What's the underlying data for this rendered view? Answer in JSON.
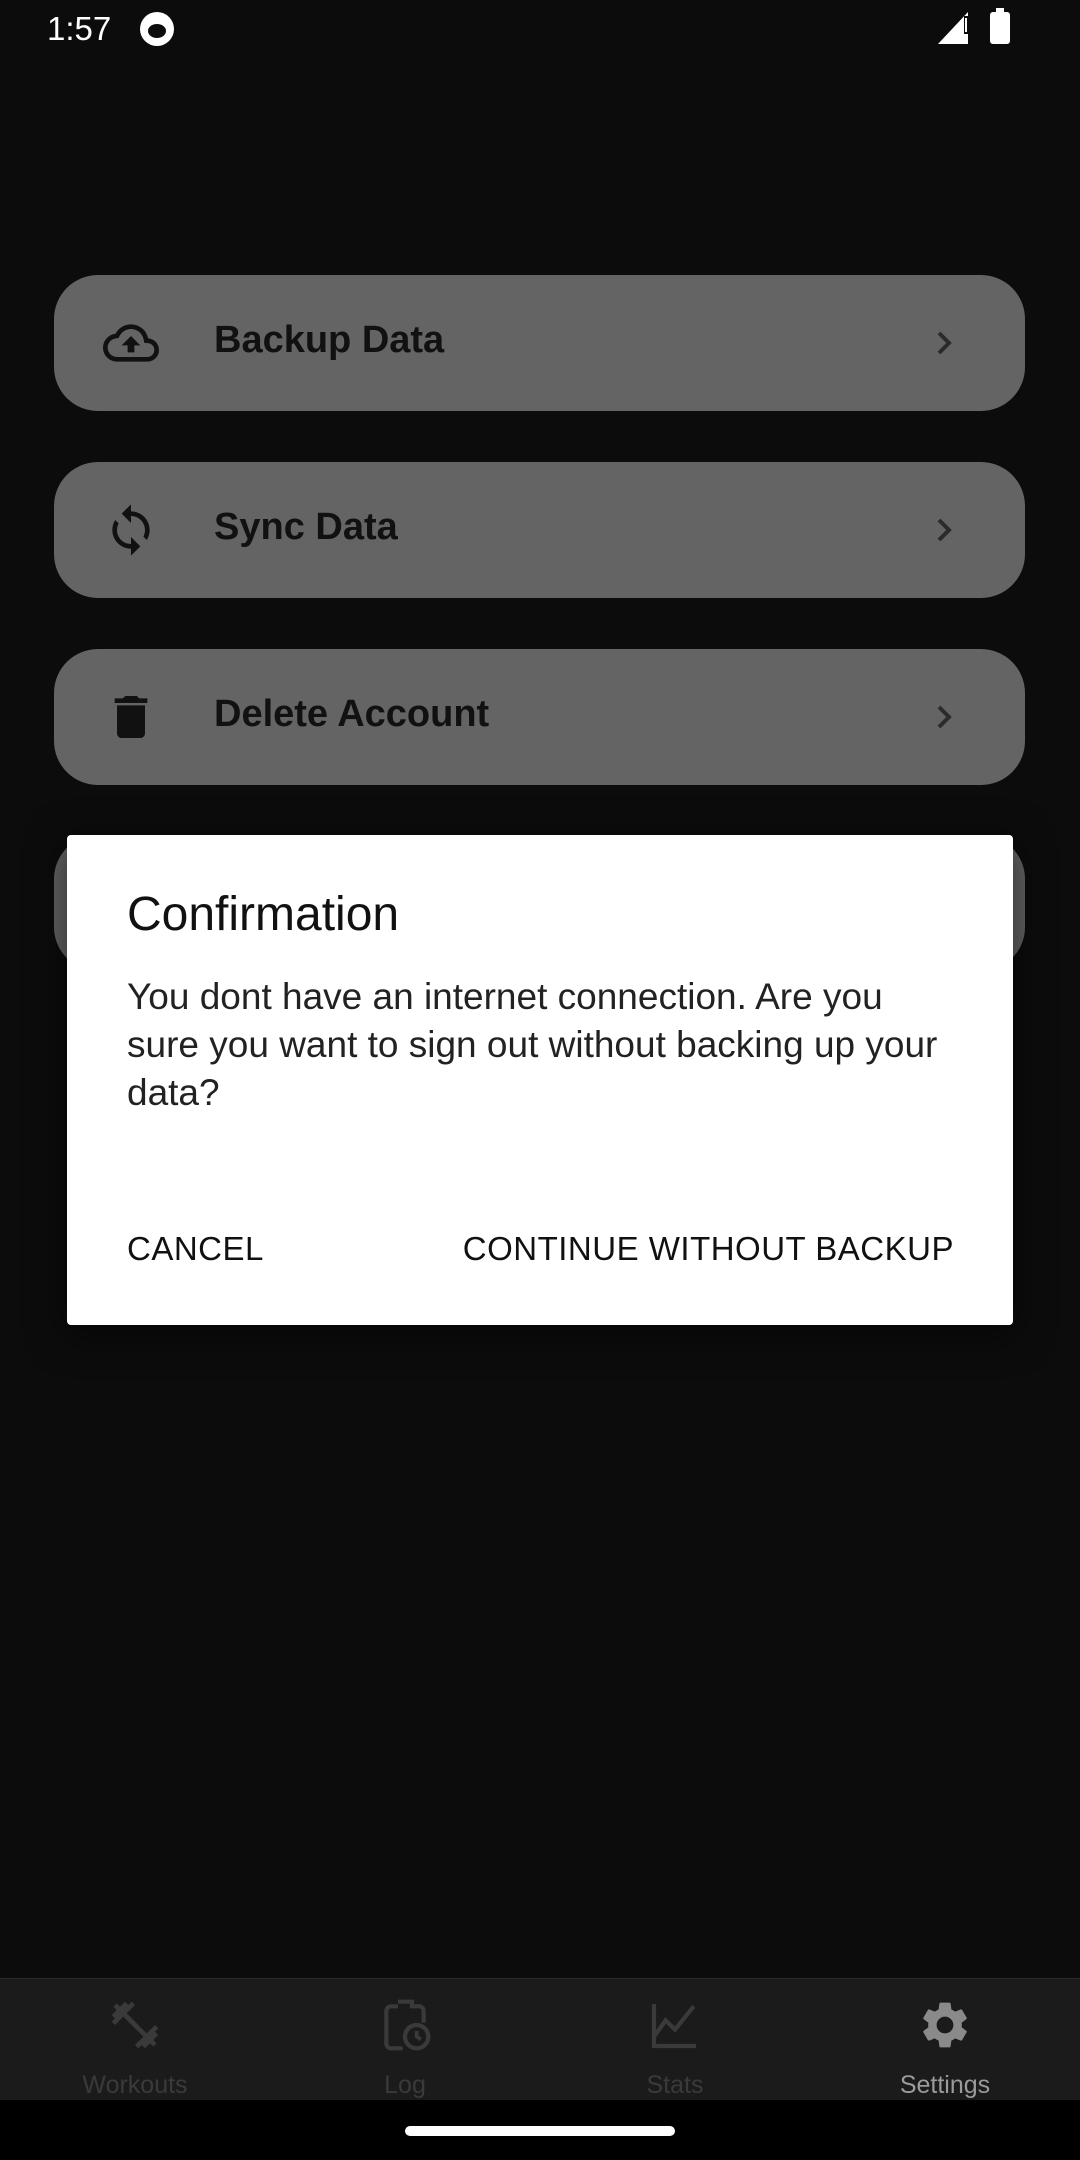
{
  "status_bar": {
    "time": "1:57",
    "notification_icon": "cat-face-icon"
  },
  "settings": {
    "items": [
      {
        "label": "Backup Data",
        "icon": "cloud-upload-icon"
      },
      {
        "label": "Sync Data",
        "icon": "sync-icon"
      },
      {
        "label": "Delete Account",
        "icon": "trash-icon"
      }
    ]
  },
  "dialog": {
    "title": "Confirmation",
    "message": "You dont have an internet connection. Are you sure you want to sign out without backing up your data?",
    "cancel_label": "CANCEL",
    "confirm_label": "CONTINUE WITHOUT BACKUP"
  },
  "bottom_nav": {
    "items": [
      {
        "label": "Workouts",
        "icon": "dumbbell-icon"
      },
      {
        "label": "Log",
        "icon": "clipboard-clock-icon"
      },
      {
        "label": "Stats",
        "icon": "line-chart-icon"
      },
      {
        "label": "Settings",
        "icon": "gear-icon"
      }
    ],
    "active": "Settings"
  },
  "colors": {
    "background": "#0c0c0c",
    "card_dimmed": "#646464",
    "dialog_bg": "#ffffff"
  }
}
